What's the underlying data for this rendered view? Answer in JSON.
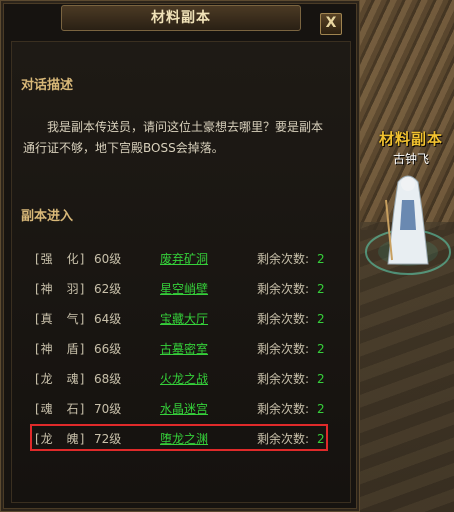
{
  "window": {
    "title": "材料副本",
    "close_label": "X"
  },
  "dialog": {
    "heading": "对话描述",
    "text": "我是副本传送员，请问这位土豪想去哪里？要是副本通行证不够，地下宫殿BOSS会掉落。"
  },
  "dungeon": {
    "heading": "副本进入",
    "rows": [
      {
        "category": "[强　化]",
        "level": "60级",
        "destination": "废弃矿洞",
        "remaining_label": "剩余次数:",
        "count": "2"
      },
      {
        "category": "[神　羽]",
        "level": "62级",
        "destination": "星空峭壁",
        "remaining_label": "剩余次数:",
        "count": "2"
      },
      {
        "category": "[真　气]",
        "level": "64级",
        "destination": "宝藏大厅",
        "remaining_label": "剩余次数:",
        "count": "2"
      },
      {
        "category": "[神　盾]",
        "level": "66级",
        "destination": "古墓密室",
        "remaining_label": "剩余次数:",
        "count": "2"
      },
      {
        "category": "[龙　魂]",
        "level": "68级",
        "destination": "火龙之战",
        "remaining_label": "剩余次数:",
        "count": "2"
      },
      {
        "category": "[魂　石]",
        "level": "70级",
        "destination": "水晶迷宫",
        "remaining_label": "剩余次数:",
        "count": "2"
      },
      {
        "category": "[龙　魄]",
        "level": "72级",
        "destination": "堕龙之渊",
        "remaining_label": "剩余次数:",
        "count": "2"
      }
    ]
  },
  "npc": {
    "title": "材料副本",
    "name": "古钟飞"
  },
  "colors": {
    "link": "#35d03a",
    "heading": "#d8b878",
    "highlight": "#e02a2a",
    "npc_title": "#f2c230"
  }
}
